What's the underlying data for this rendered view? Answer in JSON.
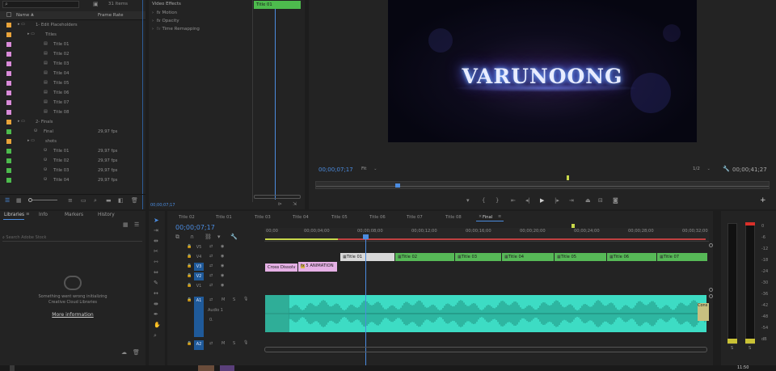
{
  "project": {
    "search_placeholder": "",
    "item_count": "31 Items",
    "columns": {
      "name": "Name",
      "frame_rate": "Frame Rate"
    },
    "items": [
      {
        "name": "1- Edit Placeholders",
        "fps": "",
        "color": "#e8a33a",
        "kind": "bin"
      },
      {
        "name": "Titles",
        "fps": "",
        "color": "#e8a33a",
        "kind": "bin"
      },
      {
        "name": "Title 01",
        "fps": "",
        "color": "#d98ad9",
        "kind": "title"
      },
      {
        "name": "Title 02",
        "fps": "",
        "color": "#d98ad9",
        "kind": "title"
      },
      {
        "name": "Title 03",
        "fps": "",
        "color": "#d98ad9",
        "kind": "title"
      },
      {
        "name": "Title 04",
        "fps": "",
        "color": "#d98ad9",
        "kind": "title"
      },
      {
        "name": "Title 05",
        "fps": "",
        "color": "#d98ad9",
        "kind": "title"
      },
      {
        "name": "Title 06",
        "fps": "",
        "color": "#d98ad9",
        "kind": "title"
      },
      {
        "name": "Title 07",
        "fps": "",
        "color": "#d98ad9",
        "kind": "title"
      },
      {
        "name": "Title 08",
        "fps": "",
        "color": "#d98ad9",
        "kind": "title"
      },
      {
        "name": "2- Finals",
        "fps": "",
        "color": "#e8a33a",
        "kind": "bin"
      },
      {
        "name": "Final",
        "fps": "29,97 fps",
        "color": "#4dbb4d",
        "kind": "seq"
      },
      {
        "name": "shots",
        "fps": "",
        "color": "#e8a33a",
        "kind": "bin"
      },
      {
        "name": "Title 01",
        "fps": "29,97 fps",
        "color": "#4dbb4d",
        "kind": "seq"
      },
      {
        "name": "Title 02",
        "fps": "29,97 fps",
        "color": "#4dbb4d",
        "kind": "seq"
      },
      {
        "name": "Title 03",
        "fps": "29,97 fps",
        "color": "#4dbb4d",
        "kind": "seq"
      },
      {
        "name": "Title 04",
        "fps": "29,97 fps",
        "color": "#4dbb4d",
        "kind": "seq"
      }
    ]
  },
  "effect_controls": {
    "section": "Video Effects",
    "effects": [
      "Motion",
      "Opacity",
      "Time Remapping"
    ],
    "clip_label": "Title 01",
    "timecode": "00;00;07;17"
  },
  "program": {
    "video_title": "VARUNOONG",
    "timecode": "00;00;07;17",
    "fit": "Fit",
    "resolution": "1/2",
    "duration": "00;00;41;27"
  },
  "libraries": {
    "tabs": [
      "Libraries",
      "Info",
      "Markers",
      "History"
    ],
    "search_placeholder": "Search Adobe Stock",
    "error_line1": "Something went wrong initializing",
    "error_line2": "Creative Cloud Libraries",
    "link": "More information"
  },
  "timeline": {
    "tabs": [
      "Title 02",
      "Title 01",
      "Title 03",
      "Title 04",
      "Title 05",
      "Title 06",
      "Title 07",
      "Title 08",
      "Final"
    ],
    "timecode": "00;00;07;17",
    "ruler": [
      "00;00",
      "00;00;04;00",
      "00;00;08;00",
      "00;00;12;00",
      "00;00;16;00",
      "00;00;20;00",
      "00;00;24;00",
      "00;00;28;00",
      "00;00;32;00"
    ],
    "tracks": [
      "V5",
      "V4",
      "V3",
      "V2",
      "V1",
      "A1",
      "A2"
    ],
    "audio_track_name": "Audio 1",
    "audio_track_name2": "Audio 2",
    "volume": "0.",
    "clips_v4": [
      "Title 01",
      "Title 02",
      "Title 03",
      "Title 04",
      "Title 05",
      "Title 06",
      "Title 07"
    ],
    "clip_v3_a": "Cross Dissolv",
    "clip_v3_b": "5 ANIMATION",
    "audio_tail": "Cons"
  },
  "meters": {
    "scale": [
      "0",
      "-6",
      "-12",
      "-18",
      "-24",
      "-30",
      "-36",
      "-42",
      "-48",
      "-54",
      "dB"
    ],
    "solo_labels": [
      "S",
      "S"
    ]
  },
  "taskbar": {
    "time": "11:50"
  }
}
